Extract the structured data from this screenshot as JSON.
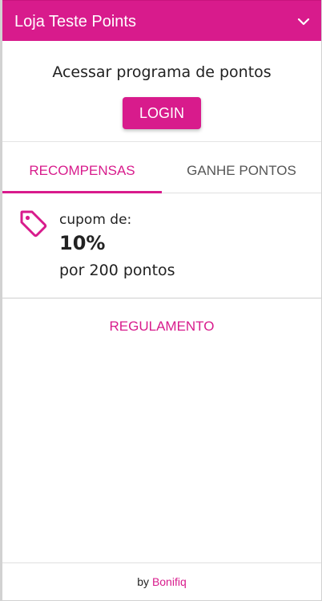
{
  "header": {
    "title": "Loja Teste Points",
    "chevron_icon": "chevron-down-icon"
  },
  "access": {
    "prompt": "Acessar programa de pontos",
    "login_label": "LOGIN"
  },
  "tabs": [
    {
      "label": "RECOMPENSAS",
      "active": true
    },
    {
      "label": "GANHE PONTOS",
      "active": false
    }
  ],
  "reward": {
    "icon": "tag-icon",
    "label": "cupom de:",
    "value": "10%",
    "points": "por 200 pontos"
  },
  "rules_label": "REGULAMENTO",
  "footer": {
    "by": "by",
    "brand": "Bonifiq"
  },
  "colors": {
    "accent": "#d81b8c",
    "text": "#222222",
    "muted": "#555555"
  }
}
